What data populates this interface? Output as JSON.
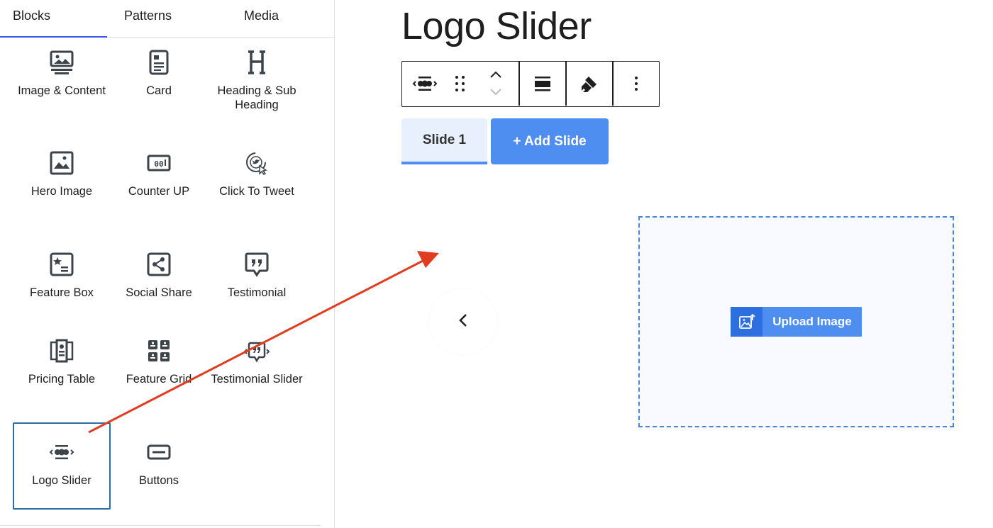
{
  "tabs": [
    {
      "label": "Blocks",
      "active": true
    },
    {
      "label": "Patterns",
      "active": false
    },
    {
      "label": "Media",
      "active": false
    }
  ],
  "blocks": [
    {
      "label": "Image & Content",
      "icon": "image-content-icon"
    },
    {
      "label": "Card",
      "icon": "card-icon"
    },
    {
      "label": "Heading & Sub Heading",
      "icon": "heading-icon"
    },
    {
      "label": "Hero Image",
      "icon": "hero-image-icon"
    },
    {
      "label": "Counter UP",
      "icon": "counter-icon"
    },
    {
      "label": "Click To Tweet",
      "icon": "tweet-icon"
    },
    {
      "label": "Feature Box",
      "icon": "feature-box-icon"
    },
    {
      "label": "Social Share",
      "icon": "share-icon"
    },
    {
      "label": "Testimonial",
      "icon": "testimonial-icon"
    },
    {
      "label": "Pricing Table",
      "icon": "pricing-table-icon"
    },
    {
      "label": "Feature Grid",
      "icon": "feature-grid-icon"
    },
    {
      "label": "Testimonial Slider",
      "icon": "testimonial-slider-icon"
    },
    {
      "label": "Logo Slider",
      "icon": "logo-slider-icon",
      "selected": true
    },
    {
      "label": "Buttons",
      "icon": "buttons-icon"
    }
  ],
  "editor": {
    "title": "Logo Slider",
    "toolbar": [
      "logo-slider-icon",
      "drag-handle-icon",
      "move-up-down-icon",
      "align-icon",
      "style-brush-icon",
      "more-options-icon"
    ],
    "slide_tab_label": "Slide 1",
    "add_slide_label": "+ Add Slide",
    "upload_label": "Upload Image"
  },
  "colors": {
    "accent": "#4e8ef0",
    "accent_dark": "#2e6fdf",
    "annotation_arrow": "#e03c20",
    "selected_border": "#2d6da3",
    "icon": "#3c434a"
  }
}
